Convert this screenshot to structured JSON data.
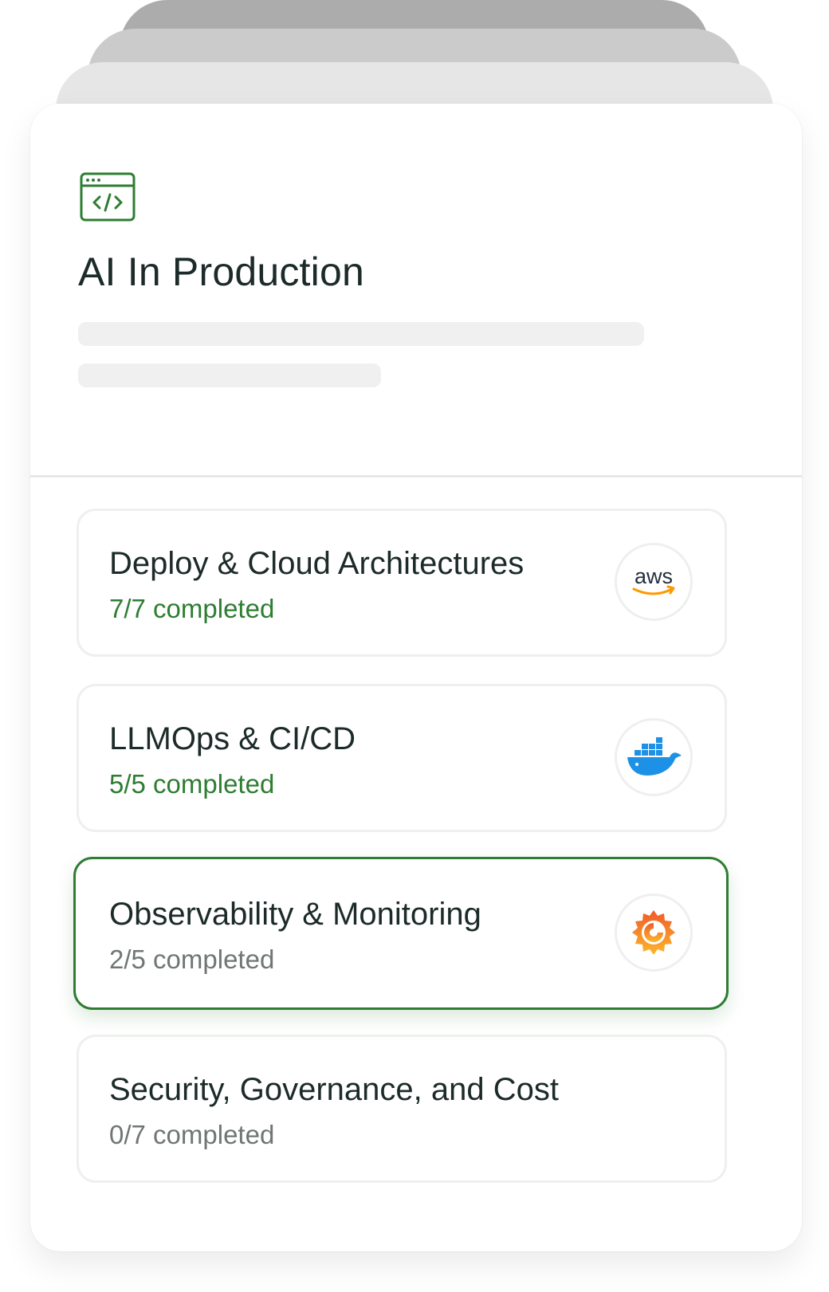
{
  "course": {
    "title": "AI In Production",
    "icon": "code-window-icon",
    "accent_color": "#2e7d32"
  },
  "modules": [
    {
      "title": "Deploy & Cloud Architectures",
      "progress": "7/7 completed",
      "completed": 7,
      "total": 7,
      "logo": "aws-logo",
      "aws_text": "aws",
      "status": "complete"
    },
    {
      "title": "LLMOps & CI/CD",
      "progress": "5/5 completed",
      "completed": 5,
      "total": 5,
      "logo": "docker-logo",
      "status": "complete"
    },
    {
      "title": "Observability & Monitoring",
      "progress": "2/5 completed",
      "completed": 2,
      "total": 5,
      "logo": "grafana-logo",
      "status": "active"
    },
    {
      "title": "Security, Governance, and Cost",
      "progress": "0/7 completed",
      "completed": 0,
      "total": 7,
      "logo": "",
      "status": "pending"
    }
  ]
}
